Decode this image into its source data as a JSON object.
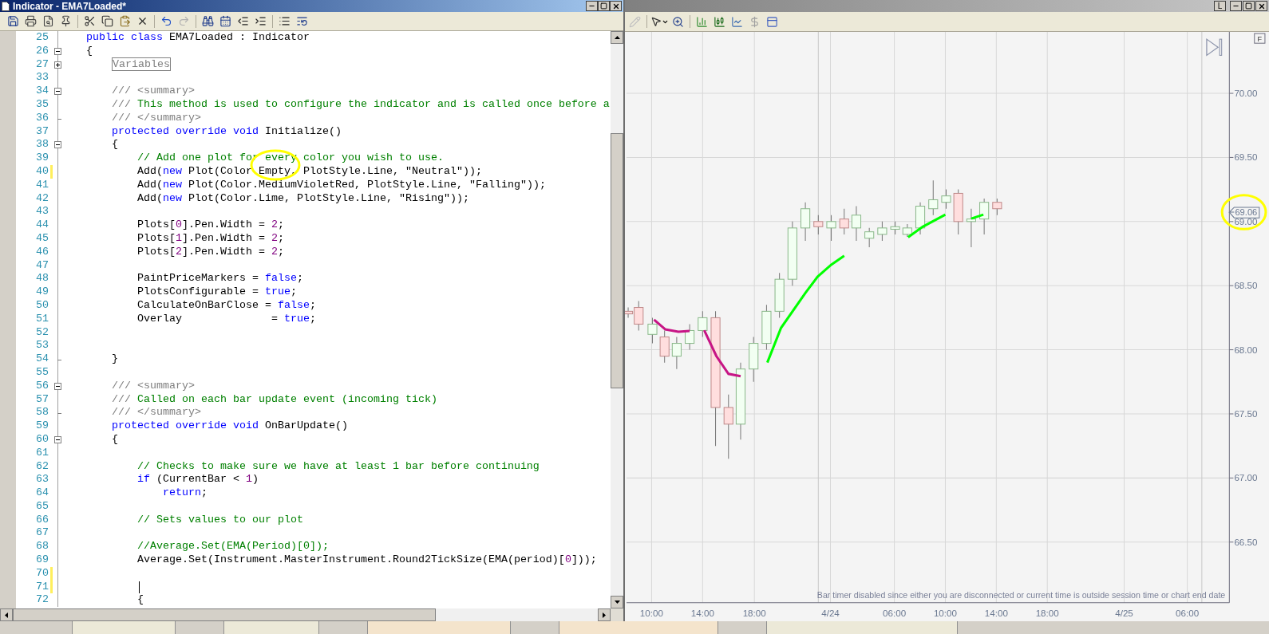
{
  "editor": {
    "title": "Indicator - EMA7Loaded*",
    "lines": [
      {
        "number": "25",
        "modified": false,
        "tokens": [
          {
            "kind": "kw",
            "text": "public class"
          },
          {
            "kind": "txt",
            "text": " EMA7Loaded : Indicator"
          }
        ]
      },
      {
        "number": "26",
        "fold": {
          "kind": "box",
          "expanded": true
        },
        "modified": false,
        "tokens": [
          {
            "kind": "txt",
            "text": "{"
          }
        ]
      },
      {
        "number": "27",
        "fold": {
          "kind": "box",
          "expanded": false
        },
        "modified": false,
        "tokens": [
          {
            "kind": "region",
            "text": "Variables"
          }
        ]
      },
      {
        "number": "33",
        "modified": false
      },
      {
        "number": "34",
        "fold": {
          "kind": "box",
          "expanded": true
        },
        "modified": false,
        "tokens": [
          {
            "kind": "doc",
            "text": "    /// <summary>"
          }
        ]
      },
      {
        "number": "35",
        "modified": false,
        "tokens": [
          {
            "kind": "doc",
            "text": "    /// "
          },
          {
            "kind": "com",
            "text": "This method is used to configure the indicator and is called once before a"
          }
        ]
      },
      {
        "number": "36",
        "fold": {
          "kind": "end"
        },
        "modified": false,
        "tokens": [
          {
            "kind": "doc",
            "text": "    /// </summary>"
          }
        ]
      },
      {
        "number": "37",
        "modified": false,
        "tokens": [
          {
            "kind": "kw",
            "text": "    protected override void"
          },
          {
            "kind": "txt",
            "text": " Initialize()"
          }
        ]
      },
      {
        "number": "38",
        "fold": {
          "kind": "box",
          "expanded": true
        },
        "modified": false,
        "tokens": [
          {
            "kind": "txt",
            "text": "    {"
          }
        ]
      },
      {
        "number": "39",
        "modified": false,
        "tokens": [
          {
            "kind": "com",
            "text": "        // Add one plot for every color you wish to use."
          }
        ]
      },
      {
        "number": "40",
        "modified": true,
        "tokens": [
          {
            "kind": "txt",
            "text": "        Add("
          },
          {
            "kind": "kw",
            "text": "new"
          },
          {
            "kind": "txt",
            "text": " Plot(Color.Empty, PlotStyle.Line, \"Neutral\"));"
          }
        ]
      },
      {
        "number": "41",
        "modified": false,
        "tokens": [
          {
            "kind": "txt",
            "text": "        Add("
          },
          {
            "kind": "kw",
            "text": "new"
          },
          {
            "kind": "txt",
            "text": " Plot(Color.MediumVioletRed, PlotStyle.Line, \"Falling\"));"
          }
        ]
      },
      {
        "number": "42",
        "modified": false,
        "tokens": [
          {
            "kind": "txt",
            "text": "        Add("
          },
          {
            "kind": "kw",
            "text": "new"
          },
          {
            "kind": "txt",
            "text": " Plot(Color.Lime, PlotStyle.Line, \"Rising\"));"
          }
        ]
      },
      {
        "number": "43",
        "modified": false
      },
      {
        "number": "44",
        "modified": false,
        "tokens": [
          {
            "kind": "txt",
            "text": "        Plots["
          },
          {
            "kind": "num",
            "text": "0"
          },
          {
            "kind": "txt",
            "text": "].Pen.Width = "
          },
          {
            "kind": "num",
            "text": "2"
          },
          {
            "kind": "txt",
            "text": ";"
          }
        ]
      },
      {
        "number": "45",
        "modified": false,
        "tokens": [
          {
            "kind": "txt",
            "text": "        Plots["
          },
          {
            "kind": "num",
            "text": "1"
          },
          {
            "kind": "txt",
            "text": "].Pen.Width = "
          },
          {
            "kind": "num",
            "text": "2"
          },
          {
            "kind": "txt",
            "text": ";"
          }
        ]
      },
      {
        "number": "46",
        "modified": false,
        "tokens": [
          {
            "kind": "txt",
            "text": "        Plots["
          },
          {
            "kind": "num",
            "text": "2"
          },
          {
            "kind": "txt",
            "text": "].Pen.Width = "
          },
          {
            "kind": "num",
            "text": "2"
          },
          {
            "kind": "txt",
            "text": ";"
          }
        ]
      },
      {
        "number": "47",
        "modified": false
      },
      {
        "number": "48",
        "modified": false,
        "tokens": [
          {
            "kind": "txt",
            "text": "        PaintPriceMarkers = "
          },
          {
            "kind": "kw",
            "text": "false"
          },
          {
            "kind": "txt",
            "text": ";"
          }
        ]
      },
      {
        "number": "49",
        "modified": false,
        "tokens": [
          {
            "kind": "txt",
            "text": "        PlotsConfigurable = "
          },
          {
            "kind": "kw",
            "text": "true"
          },
          {
            "kind": "txt",
            "text": ";"
          }
        ]
      },
      {
        "number": "50",
        "modified": false,
        "tokens": [
          {
            "kind": "txt",
            "text": "        CalculateOnBarClose = "
          },
          {
            "kind": "kw",
            "text": "false"
          },
          {
            "kind": "txt",
            "text": ";"
          }
        ]
      },
      {
        "number": "51",
        "modified": false,
        "tokens": [
          {
            "kind": "txt",
            "text": "        Overlay              = "
          },
          {
            "kind": "kw",
            "text": "true"
          },
          {
            "kind": "txt",
            "text": ";"
          }
        ]
      },
      {
        "number": "52",
        "modified": false
      },
      {
        "number": "53",
        "modified": false
      },
      {
        "number": "54",
        "fold": {
          "kind": "end"
        },
        "modified": false,
        "tokens": [
          {
            "kind": "txt",
            "text": "    }"
          }
        ]
      },
      {
        "number": "55",
        "modified": false
      },
      {
        "number": "56",
        "fold": {
          "kind": "box",
          "expanded": true
        },
        "modified": false,
        "tokens": [
          {
            "kind": "doc",
            "text": "    /// <summary>"
          }
        ]
      },
      {
        "number": "57",
        "modified": false,
        "tokens": [
          {
            "kind": "doc",
            "text": "    /// "
          },
          {
            "kind": "com",
            "text": "Called on each bar update event (incoming tick)"
          }
        ]
      },
      {
        "number": "58",
        "fold": {
          "kind": "end"
        },
        "modified": false,
        "tokens": [
          {
            "kind": "doc",
            "text": "    /// </summary>"
          }
        ]
      },
      {
        "number": "59",
        "modified": false,
        "tokens": [
          {
            "kind": "kw",
            "text": "    protected override void"
          },
          {
            "kind": "txt",
            "text": " OnBarUpdate()"
          }
        ]
      },
      {
        "number": "60",
        "fold": {
          "kind": "box",
          "expanded": true
        },
        "modified": false,
        "tokens": [
          {
            "kind": "txt",
            "text": "    {"
          }
        ]
      },
      {
        "number": "61",
        "modified": false
      },
      {
        "number": "62",
        "modified": false,
        "tokens": [
          {
            "kind": "com",
            "text": "        // Checks to make sure we have at least 1 bar before continuing"
          }
        ]
      },
      {
        "number": "63",
        "modified": false,
        "tokens": [
          {
            "kind": "kw",
            "text": "        if"
          },
          {
            "kind": "txt",
            "text": " (CurrentBar < "
          },
          {
            "kind": "num",
            "text": "1"
          },
          {
            "kind": "txt",
            "text": ")"
          }
        ]
      },
      {
        "number": "64",
        "modified": false,
        "tokens": [
          {
            "kind": "kw",
            "text": "            return"
          },
          {
            "kind": "txt",
            "text": ";"
          }
        ]
      },
      {
        "number": "65",
        "modified": false
      },
      {
        "number": "66",
        "modified": false,
        "tokens": [
          {
            "kind": "com",
            "text": "        // Sets values to our plot"
          }
        ]
      },
      {
        "number": "67",
        "modified": false
      },
      {
        "number": "68",
        "modified": false,
        "tokens": [
          {
            "kind": "com",
            "text": "        //Average.Set(EMA(Period)[0]);"
          }
        ]
      },
      {
        "number": "69",
        "modified": false,
        "tokens": [
          {
            "kind": "txt",
            "text": "        Average.Set(Instrument.MasterInstrument.Round2TickSize(EMA(period)["
          },
          {
            "kind": "num",
            "text": "0"
          },
          {
            "kind": "txt",
            "text": "]));"
          }
        ]
      },
      {
        "number": "70",
        "modified": true
      },
      {
        "number": "71",
        "modified": true
      },
      {
        "number": "72",
        "modified": false,
        "tokens": [
          {
            "kind": "txt",
            "text": "        {"
          }
        ]
      }
    ]
  },
  "chart": {
    "window_button": "L",
    "corner_button": "F",
    "price_labels": [
      "70.00",
      "69.50",
      "69.00",
      "68.50",
      "68.00",
      "67.50",
      "67.00",
      "66.50"
    ],
    "price_marker": "69.06",
    "time_labels": [
      "10:00",
      "14:00",
      "18:00",
      "4/24",
      "06:00",
      "10:00",
      "14:00",
      "18:00",
      "4/25",
      "06:00"
    ],
    "notice": "Bar timer disabled since either you are disconnected or current time is outside session time or chart end date"
  }
}
